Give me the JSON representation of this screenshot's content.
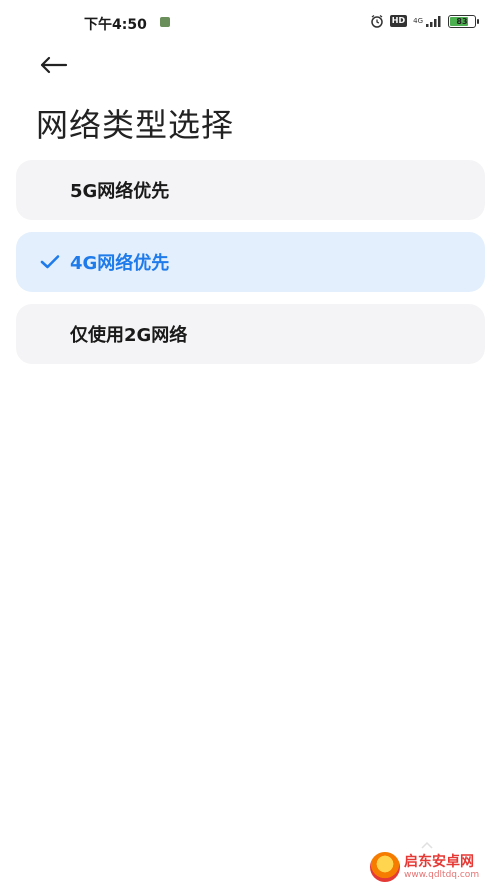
{
  "status": {
    "time": "下午4:50",
    "hd": "HD",
    "network": "4G",
    "battery": "83",
    "battery_level": 0.83
  },
  "header": {
    "title": "网络类型选择"
  },
  "options": [
    {
      "label": "5G网络优先",
      "selected": false
    },
    {
      "label": "4G网络优先",
      "selected": true
    },
    {
      "label": "仅使用2G网络",
      "selected": false
    }
  ],
  "watermark": {
    "name": "启东安卓网",
    "url": "www.qdltdq.com"
  },
  "colors": {
    "accent": "#1f7bea",
    "selected_bg": "#e3effd",
    "option_bg": "#f4f4f6"
  }
}
